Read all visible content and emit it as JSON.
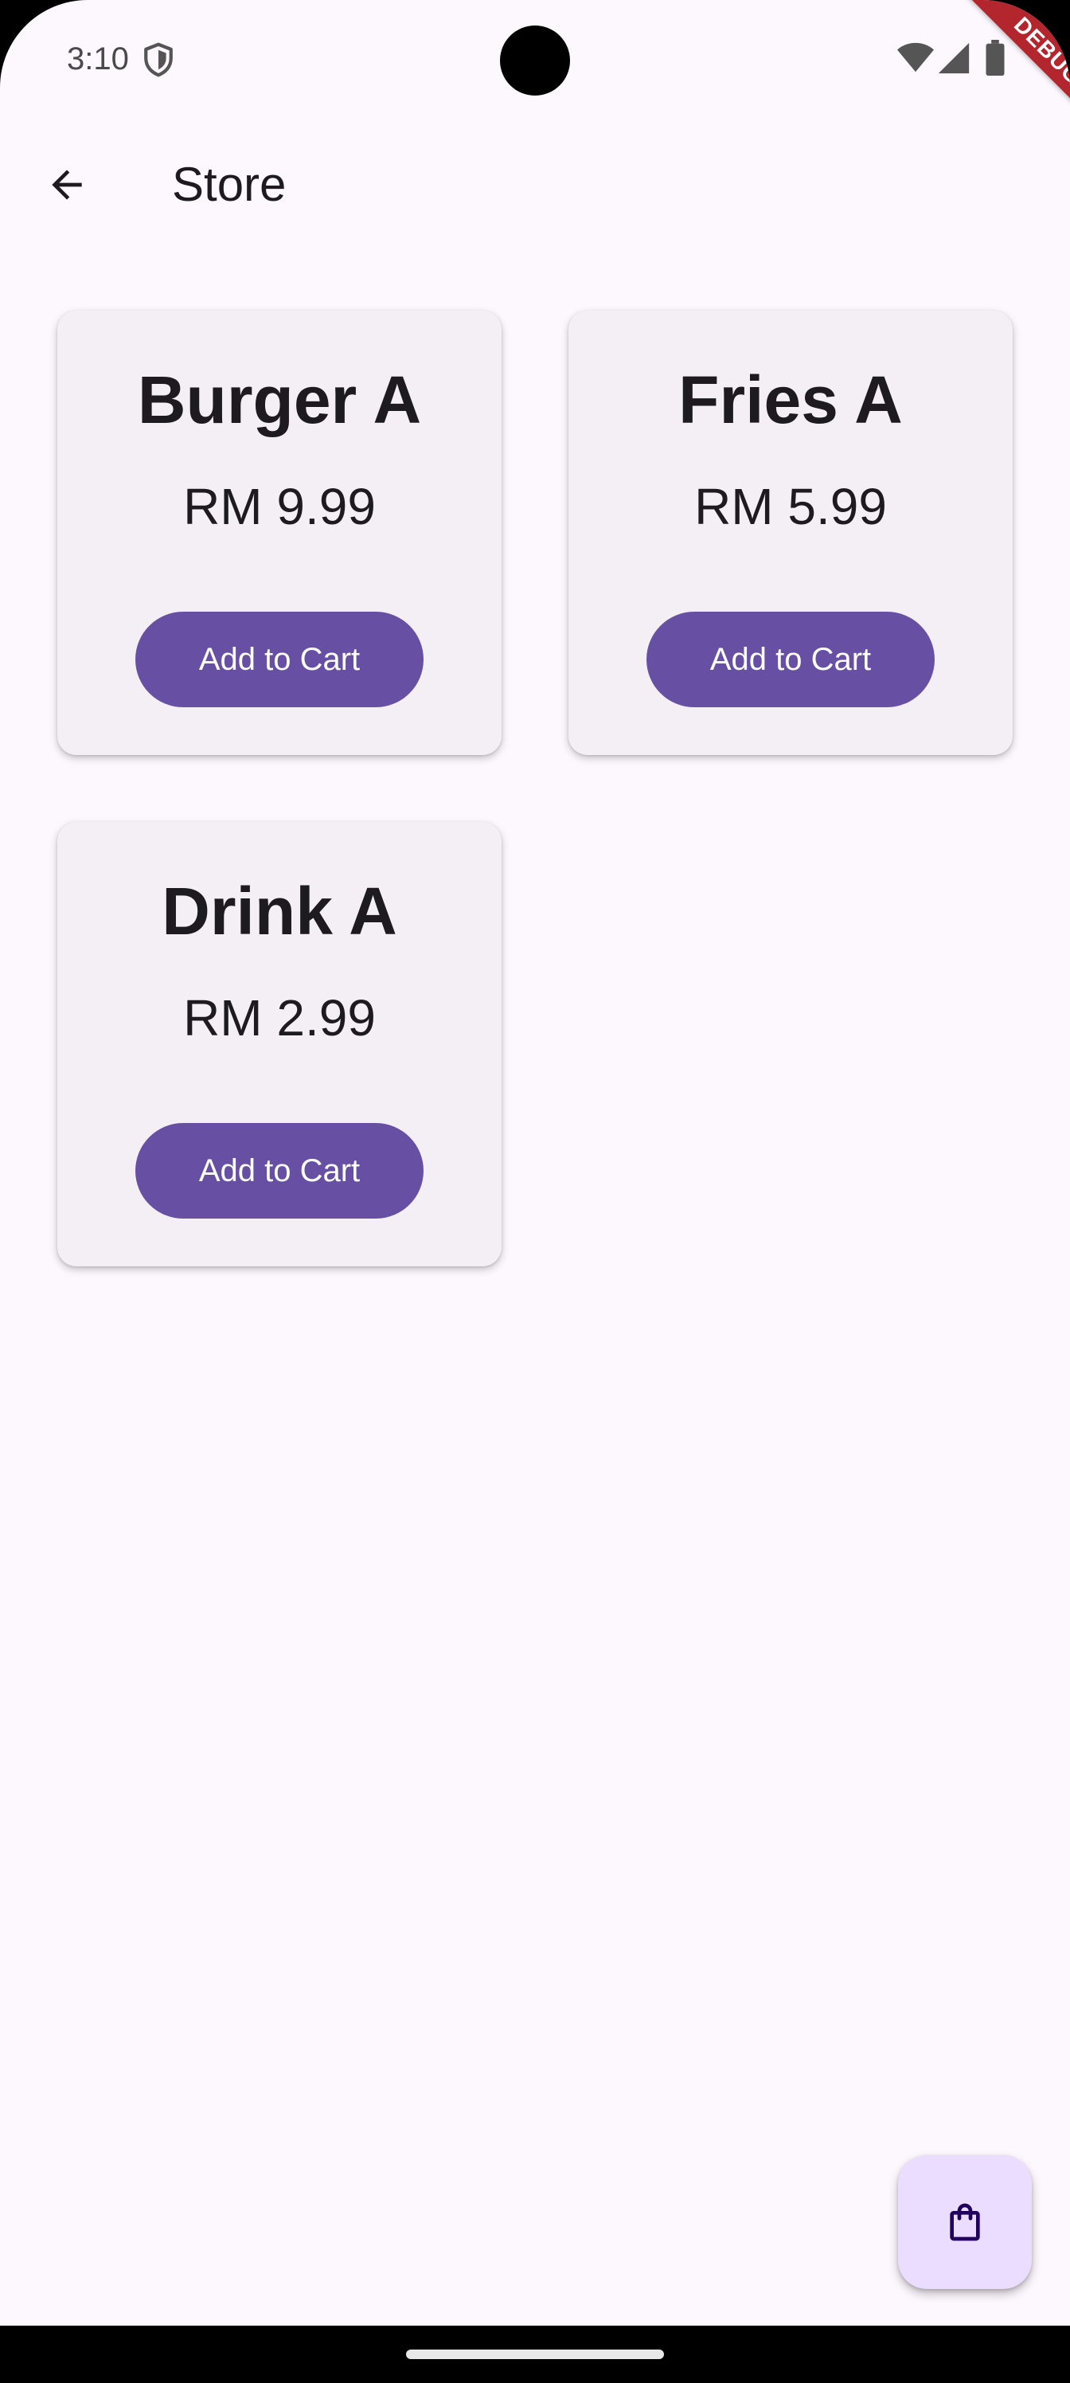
{
  "status_bar": {
    "time": "3:10",
    "icons": [
      "shield-icon",
      "wifi-icon",
      "signal-icon",
      "battery-icon"
    ]
  },
  "debug_banner": "DEBUG",
  "app_bar": {
    "back_icon": "arrow-back-icon",
    "title": "Store"
  },
  "products": [
    {
      "name": "Burger A",
      "price": "RM 9.99",
      "button_label": "Add to Cart"
    },
    {
      "name": "Fries A",
      "price": "RM 5.99",
      "button_label": "Add to Cart"
    },
    {
      "name": "Drink A",
      "price": "RM 2.99",
      "button_label": "Add to Cart"
    }
  ],
  "fab": {
    "icon": "shopping-bag-icon"
  },
  "colors": {
    "background": "#fdf7fe",
    "card": "#f4eff5",
    "primary": "#6750a4",
    "fab": "#eaddff",
    "text": "#1d1b20",
    "debug_banner": "#b3262d"
  }
}
